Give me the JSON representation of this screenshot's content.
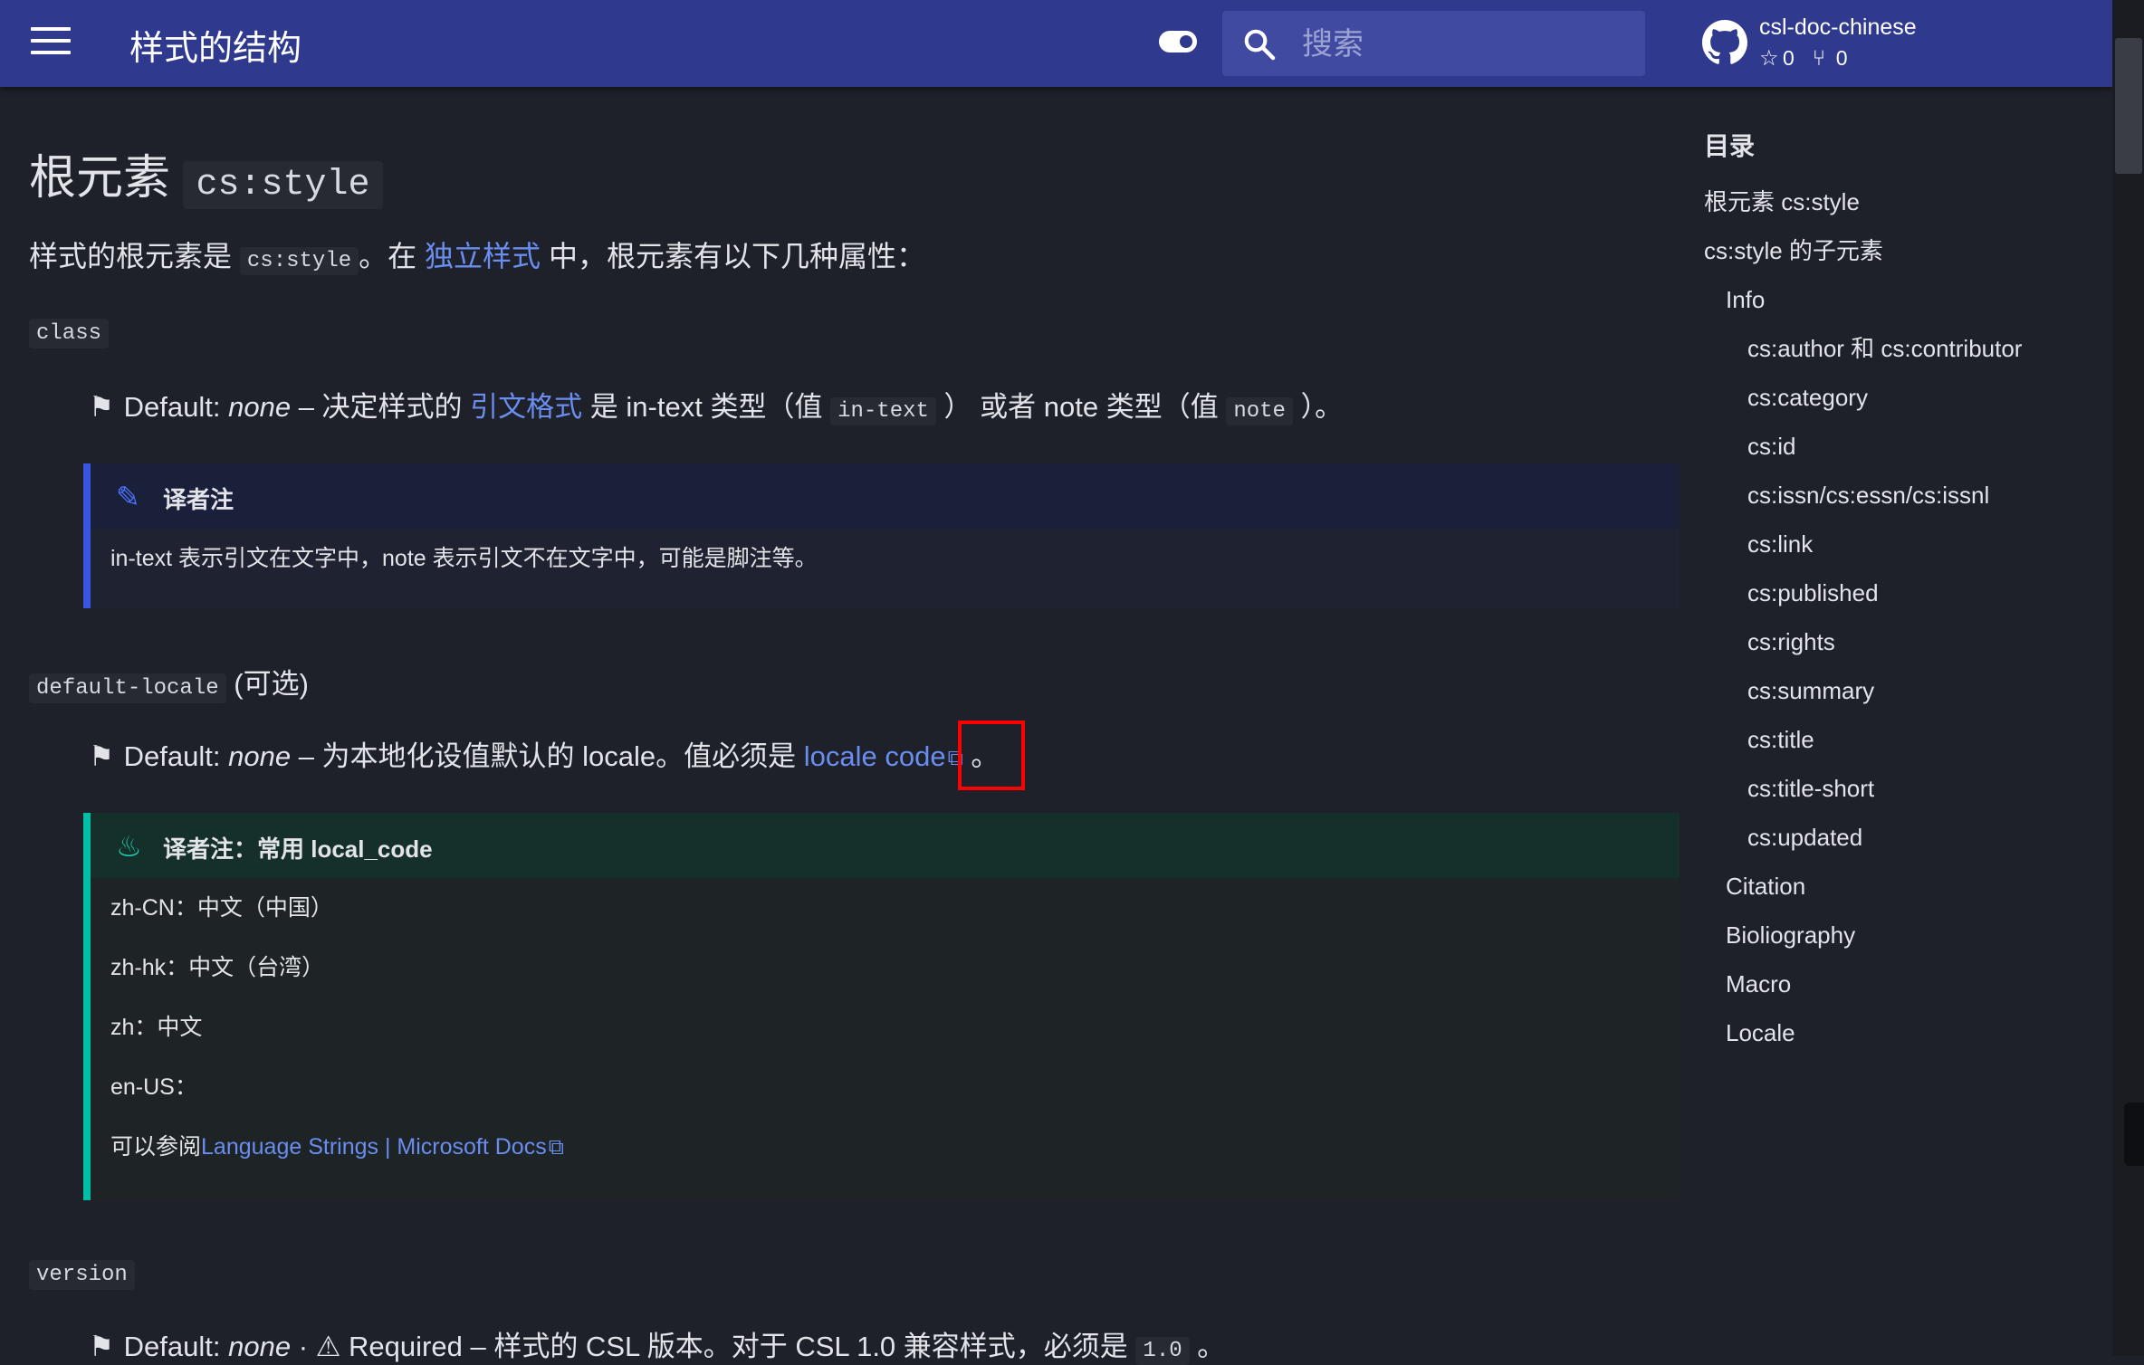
{
  "header": {
    "title": "样式的结构",
    "search_placeholder": "搜索",
    "repo": {
      "name": "csl-doc-chinese",
      "stars": "0",
      "forks": "0"
    }
  },
  "content": {
    "h1_text": "根元素",
    "h1_code": "cs:style",
    "intro": {
      "a": "样式的根元素是",
      "code": "cs:style",
      "b": "。在",
      "link": "独立样式",
      "c": "中，根元素有以下几种属性："
    },
    "class_attr": {
      "code": "class",
      "default_label": "Default:",
      "default_value": "none",
      "desc_a": "– 决定样式的",
      "link": "引文格式",
      "desc_b": "是 in-text 类型（值",
      "code1": "in-text",
      "desc_c": "） 或者 note 类型（值",
      "code2": "note",
      "desc_d": "）。"
    },
    "note1": {
      "title": "译者注",
      "body": "in-text 表示引文在文字中，note 表示引文不在文字中，可能是脚注等。"
    },
    "locale_attr": {
      "code": "default-locale",
      "suffix": "(可选)",
      "default_label": "Default:",
      "default_value": "none",
      "desc_a": "– 为本地化设值默认的 locale。值必须是",
      "link": "locale code",
      "desc_b": "。"
    },
    "note2": {
      "title": "译者注：常用 local_code",
      "lines": [
        "zh-CN：中文（中国）",
        "zh-hk：中文（台湾）",
        "zh：中文",
        "en-US："
      ],
      "ref_prefix": "可以参阅",
      "ref_link": "Language Strings | Microsoft Docs"
    },
    "version_attr": {
      "code": "version",
      "default_label": "Default:",
      "default_value": "none",
      "required": "· ⚠ Required",
      "desc_a": "– 样式的 CSL 版本。对于 CSL 1.0 兼容样式，必须是",
      "code1": "1.0",
      "desc_b": "。"
    }
  },
  "toc": {
    "title": "目录",
    "items": [
      {
        "label": "根元素 cs:style",
        "level": 1
      },
      {
        "label": "cs:style 的子元素",
        "level": 1
      },
      {
        "label": "Info",
        "level": 2
      },
      {
        "label": "cs:author 和 cs:contributor",
        "level": 3
      },
      {
        "label": "cs:category",
        "level": 3
      },
      {
        "label": "cs:id",
        "level": 3
      },
      {
        "label": "cs:issn/cs:essn/cs:issnl",
        "level": 3
      },
      {
        "label": "cs:link",
        "level": 3
      },
      {
        "label": "cs:published",
        "level": 3
      },
      {
        "label": "cs:rights",
        "level": 3
      },
      {
        "label": "cs:summary",
        "level": 3
      },
      {
        "label": "cs:title",
        "level": 3
      },
      {
        "label": "cs:title-short",
        "level": 3
      },
      {
        "label": "cs:updated",
        "level": 3
      },
      {
        "label": "Citation",
        "level": 2
      },
      {
        "label": "Bioliography",
        "level": 2
      },
      {
        "label": "Macro",
        "level": 2
      },
      {
        "label": "Locale",
        "level": 2
      }
    ]
  },
  "colors": {
    "header_bg": "#2f3a8f",
    "page_bg": "#1e2129",
    "link": "#6a8ef0",
    "note_accent": "#3a55e0",
    "tip_accent": "#00bfa5",
    "highlight": "#ff0000"
  },
  "icons": {
    "menu": "hamburger-icon",
    "toggle": "palette-toggle-icon",
    "search": "search-icon",
    "repo": "github-icon",
    "star": "star-icon",
    "fork": "fork-icon",
    "flag": "flag-icon",
    "pencil": "pencil-icon",
    "fire": "fire-icon",
    "external": "external-link-icon"
  }
}
